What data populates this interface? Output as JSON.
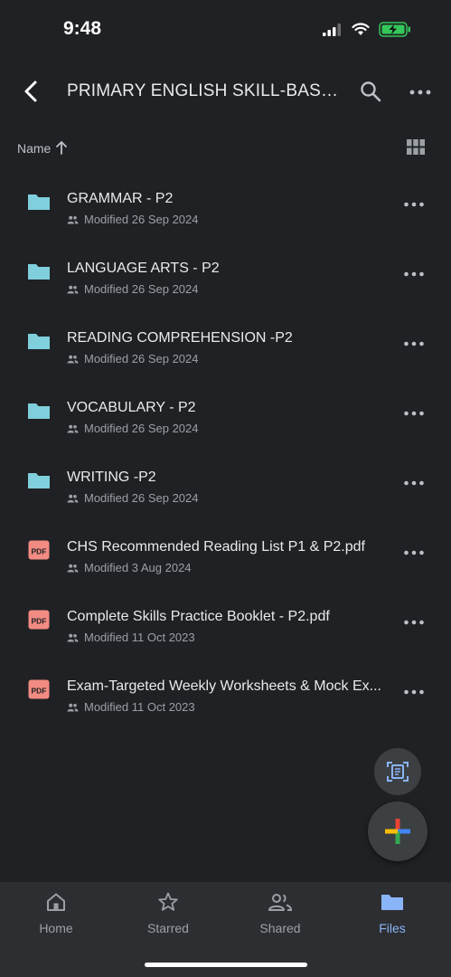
{
  "status": {
    "time": "9:48"
  },
  "header": {
    "title": "PRIMARY ENGLISH SKILL-BASE..."
  },
  "sort": {
    "label": "Name"
  },
  "files": [
    {
      "type": "folder",
      "name": "GRAMMAR - P2",
      "meta": "Modified 26 Sep 2024"
    },
    {
      "type": "folder",
      "name": "LANGUAGE ARTS - P2",
      "meta": "Modified 26 Sep 2024"
    },
    {
      "type": "folder",
      "name": "READING COMPREHENSION -P2",
      "meta": "Modified 26 Sep 2024"
    },
    {
      "type": "folder",
      "name": "VOCABULARY - P2",
      "meta": "Modified 26 Sep 2024"
    },
    {
      "type": "folder",
      "name": "WRITING -P2",
      "meta": "Modified 26 Sep 2024"
    },
    {
      "type": "pdf",
      "name": "CHS Recommended Reading List P1 & P2.pdf",
      "meta": "Modified 3 Aug 2024"
    },
    {
      "type": "pdf",
      "name": "Complete Skills Practice Booklet - P2.pdf",
      "meta": "Modified 11 Oct 2023"
    },
    {
      "type": "pdf",
      "name": "Exam-Targeted Weekly Worksheets & Mock Ex...",
      "meta": "Modified 11 Oct 2023"
    }
  ],
  "pdf_badge": "PDF",
  "nav": [
    {
      "label": "Home",
      "icon": "home-icon",
      "active": false
    },
    {
      "label": "Starred",
      "icon": "star-icon",
      "active": false
    },
    {
      "label": "Shared",
      "icon": "people-icon",
      "active": false
    },
    {
      "label": "Files",
      "icon": "folder-icon",
      "active": true
    }
  ],
  "colors": {
    "background": "#202124",
    "folder": "#7fcfdc",
    "pdf": "#f28b82",
    "accent": "#8ab4f8",
    "battery": "#34c759"
  }
}
